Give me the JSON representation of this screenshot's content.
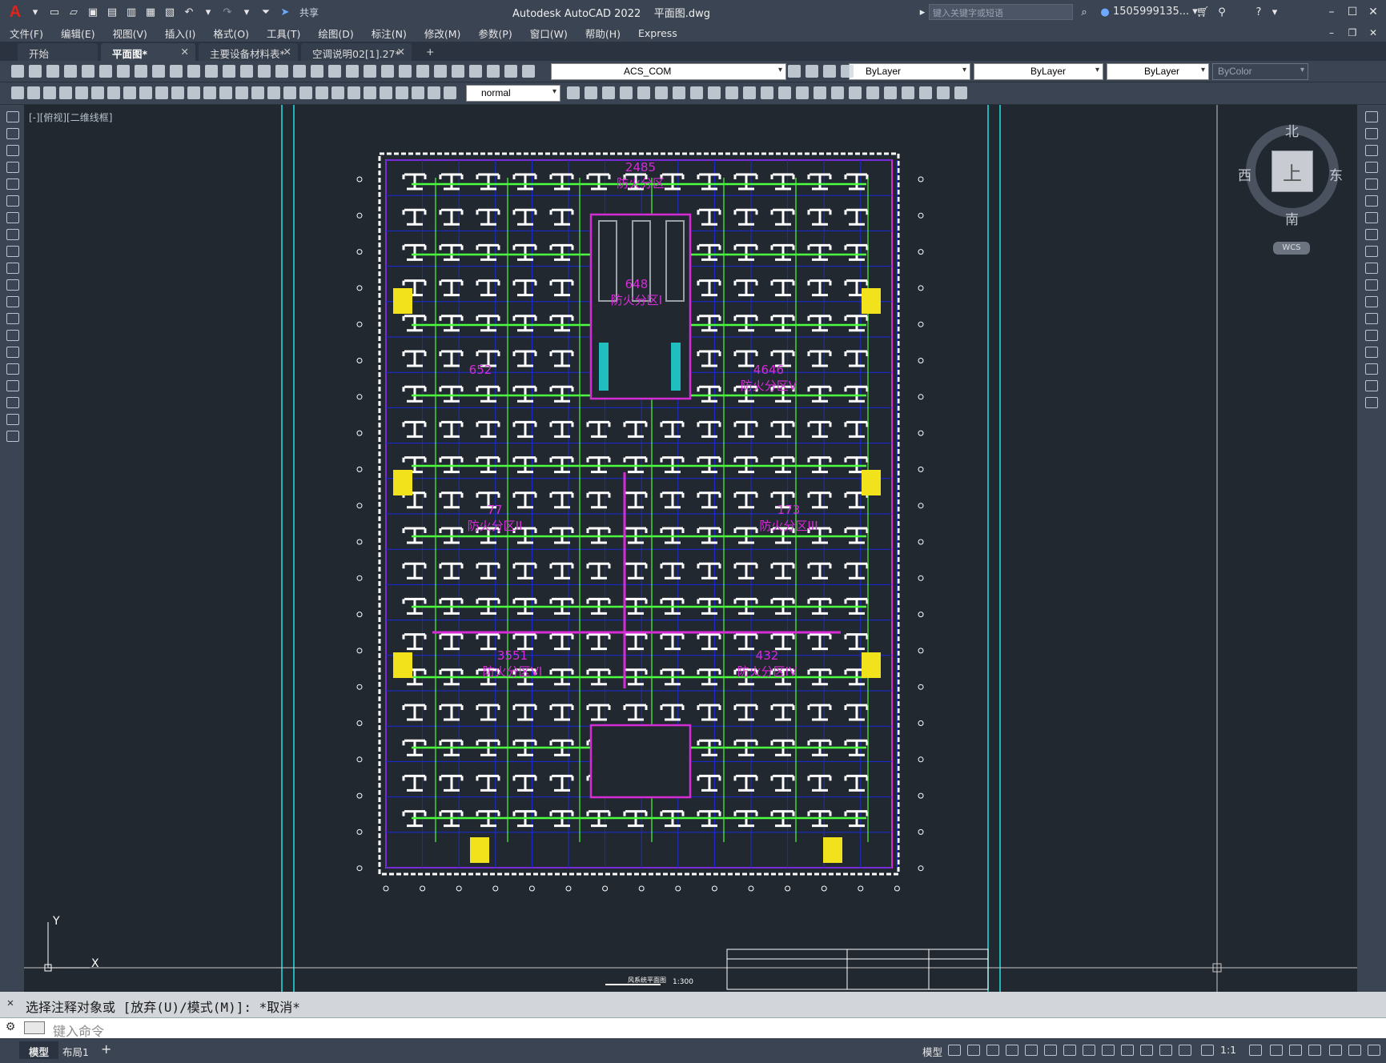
{
  "title_bar": {
    "app_logo": "A",
    "share_label": "共享",
    "title": "Autodesk AutoCAD 2022    平面图.dwg",
    "search_placeholder": "键入关键字或短语",
    "user": "1505999135... ▾"
  },
  "menu": [
    "文件(F)",
    "编辑(E)",
    "视图(V)",
    "插入(I)",
    "格式(O)",
    "工具(T)",
    "绘图(D)",
    "标注(N)",
    "修改(M)",
    "参数(P)",
    "窗口(W)",
    "帮助(H)",
    "Express"
  ],
  "tabs": [
    {
      "label": "开始",
      "closable": false,
      "active": false
    },
    {
      "label": "平面图*",
      "closable": true,
      "active": true
    },
    {
      "label": "主要设备材料表*",
      "closable": true,
      "active": false
    },
    {
      "label": "空调说明02[1].27*",
      "closable": true,
      "active": false
    }
  ],
  "toolbar1": {
    "layer": "ACS_COM",
    "color": "ByLayer",
    "linetype": "ByLayer",
    "lineweight": "ByLayer",
    "plotstyle": "ByColor"
  },
  "toolbar2": {
    "text_style": "normal"
  },
  "viewport": {
    "label": "[-][俯视][二维线框]"
  },
  "viewcube": {
    "north": "北",
    "south": "南",
    "east": "东",
    "west": "西",
    "top_face": "上",
    "wcs": "WCS"
  },
  "ucs": {
    "x_label": "X",
    "y_label": "Y"
  },
  "drawing": {
    "zones": [
      {
        "area": "2485",
        "name": "防火分区"
      },
      {
        "area": "648",
        "name": "防火分区I"
      },
      {
        "area": "652",
        "name": ""
      },
      {
        "area": "4646",
        "name": "防火分区V"
      },
      {
        "area": "77",
        "name": "防火分区II"
      },
      {
        "area": "173",
        "name": "防火分区III"
      },
      {
        "area": "3551",
        "name": "防火分区VI"
      },
      {
        "area": "432",
        "name": "防火分区IV"
      }
    ],
    "title_block_scale": "1:300",
    "title_block_caption": "风系统平面图"
  },
  "command": {
    "history": "选择注释对象或 [放弃(U)/模式(M)]: *取消*",
    "placeholder": "键入命令"
  },
  "status": {
    "layouts": [
      "模型",
      "布局1"
    ],
    "mode_label": "模型",
    "scale": "1:1"
  },
  "colors": {
    "canvas_bg": "#212830",
    "chrome": "#3b4453",
    "outline_white": "#ffffff",
    "grid_blue": "#1a2bdc",
    "zone_magenta": "#d62cd6",
    "duct_green": "#4cff3f",
    "yellow": "#f2e21b",
    "cyan": "#22e4e4"
  }
}
